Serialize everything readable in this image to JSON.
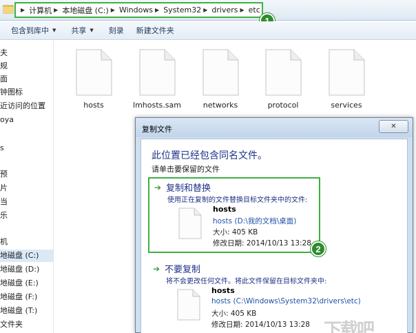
{
  "address_bar": {
    "crumbs": [
      "计算机",
      "本地磁盘 (C:)",
      "Windows",
      "System32",
      "drivers",
      "etc"
    ]
  },
  "badges": {
    "step1": "1",
    "step2": "2"
  },
  "toolbar": {
    "include_in_library": "包含到库中",
    "share": "共享",
    "burn": "刻录",
    "new_folder": "新建文件夹"
  },
  "nav": {
    "items": [
      "夫",
      "规",
      "面",
      "钟图标",
      "近访问的位置",
      "oya",
      "",
      "s",
      "预",
      "片",
      "当",
      "乐",
      "",
      "机",
      "地磁盘 (C:)",
      "地磁盘 (D:)",
      "地磁盘 (E:)",
      "地磁盘 (F:)",
      "地磁盘 (T:)",
      "文件夹"
    ]
  },
  "files": [
    "hosts",
    "lmhosts.sam",
    "networks",
    "protocol",
    "services"
  ],
  "dialog": {
    "title": "复制文件",
    "close_glyph": "✕",
    "heading": "此位置已经包含同名文件。",
    "subheading": "请单击要保留的文件",
    "replace": {
      "title": "复制和替换",
      "desc": "使用正在复制的文件替换目标文件夹中的文件:",
      "name": "hosts",
      "path": "hosts (D:\\我的文档\\桌面)",
      "size": "大小: 405 KB",
      "date": "修改日期: 2014/10/13 13:28"
    },
    "skip": {
      "title": "不要复制",
      "desc": "将不会更改任何文件。将此文件保留在目标文件夹中:",
      "name": "hosts",
      "path": "hosts (C:\\Windows\\System32\\drivers\\etc)",
      "size": "大小: 405 KB",
      "date": "修改日期: 2014/10/13 13:28"
    }
  },
  "watermark": "下载吧",
  "colors": {
    "highlight_green": "#3cb043",
    "badge_green": "#2e8b2e",
    "heading_blue": "#1e3287",
    "link_blue": "#1e52a8"
  },
  "icons": {
    "folder": "folder-icon",
    "arrow": "green-arrow-icon",
    "file": "document-icon",
    "close": "close-icon"
  }
}
